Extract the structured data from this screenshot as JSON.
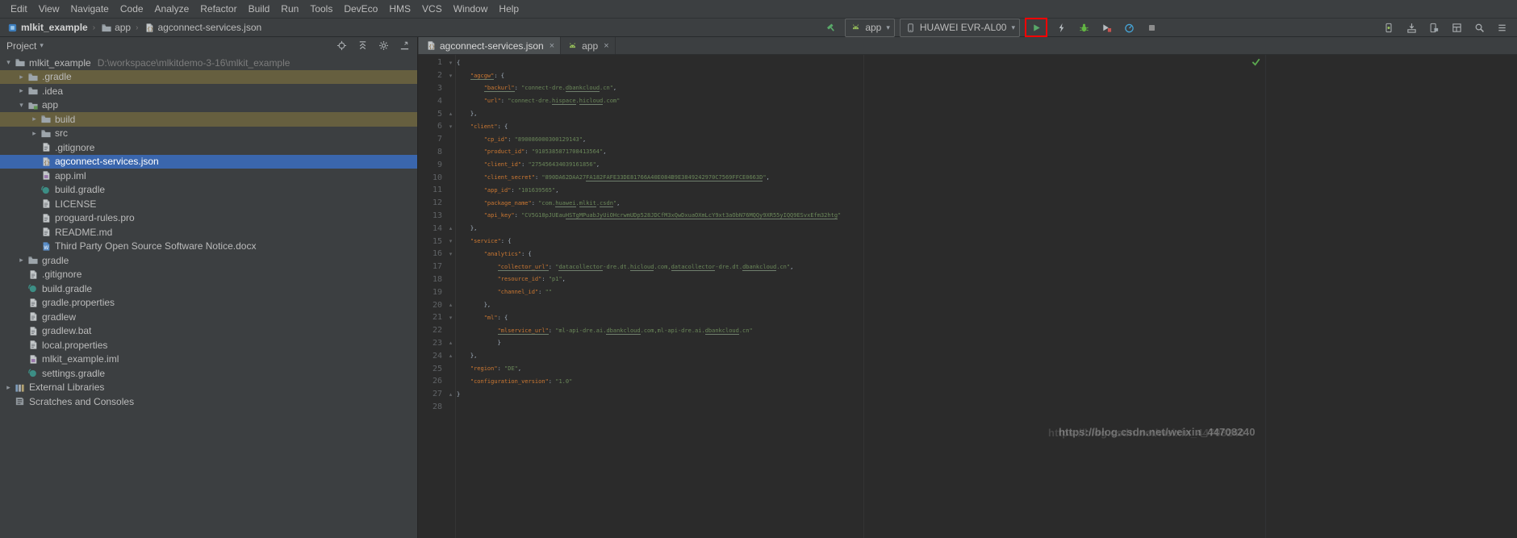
{
  "window_title": "mlkit_example - agconnect-services.json",
  "colors": {
    "panel_bg": "#3c3f41",
    "editor_bg": "#2b2b2b",
    "selection_blue": "#3a66ad",
    "excluded_row_olive": "#665f3f",
    "accent_green": "#59a869",
    "annotation_red": "#fe0000",
    "json_key": "#cc7832",
    "json_string": "#6a8759"
  },
  "menu": {
    "items": [
      "Edit",
      "View",
      "Navigate",
      "Code",
      "Analyze",
      "Refactor",
      "Build",
      "Run",
      "Tools",
      "DevEco",
      "HMS",
      "VCS",
      "Window",
      "Help"
    ]
  },
  "breadcrumbs": {
    "items": [
      {
        "label": "mlkit_example",
        "icon": "project"
      },
      {
        "label": "app",
        "icon": "folder"
      },
      {
        "label": "agconnect-services.json",
        "icon": "json"
      }
    ]
  },
  "run_toolbar": {
    "make_button": "make-project",
    "run_config": {
      "label": "app",
      "icon": "android"
    },
    "device_selector": {
      "label": "HUAWEI EVR-AL00",
      "icon": "phone"
    },
    "actions": [
      {
        "name": "run",
        "highlighted": true
      },
      {
        "name": "apply-changes"
      },
      {
        "name": "debug"
      },
      {
        "name": "run-with-coverage"
      },
      {
        "name": "profile"
      },
      {
        "name": "stop"
      }
    ],
    "right_actions": [
      {
        "name": "avd-manager"
      },
      {
        "name": "sdk-manager"
      },
      {
        "name": "device-file-explorer"
      },
      {
        "name": "layout-inspector"
      },
      {
        "name": "search-everywhere"
      },
      {
        "name": "toolbar-menu"
      }
    ]
  },
  "project_panel": {
    "title": "Project",
    "header_icons": [
      "locate",
      "collapse-all",
      "settings",
      "hide"
    ],
    "tree": [
      {
        "label": "mlkit_example",
        "path": "D:\\workspace\\mlkitdemo-3-16\\mlkit_example",
        "indent": 0,
        "icon": "folder",
        "arrow": "expanded"
      },
      {
        "label": ".gradle",
        "indent": 1,
        "icon": "folder",
        "arrow": "collapsed",
        "highlight": "excluded"
      },
      {
        "label": ".idea",
        "indent": 1,
        "icon": "folder",
        "arrow": "collapsed"
      },
      {
        "label": "app",
        "indent": 1,
        "icon": "module",
        "arrow": "expanded"
      },
      {
        "label": "build",
        "indent": 2,
        "icon": "folder",
        "arrow": "collapsed",
        "highlight": "excluded"
      },
      {
        "label": "src",
        "indent": 2,
        "icon": "folder",
        "arrow": "collapsed"
      },
      {
        "label": ".gitignore",
        "indent": 2,
        "icon": "file"
      },
      {
        "label": "agconnect-services.json",
        "indent": 2,
        "icon": "json",
        "selected": true
      },
      {
        "label": "app.iml",
        "indent": 2,
        "icon": "iml"
      },
      {
        "label": "build.gradle",
        "indent": 2,
        "icon": "gradle"
      },
      {
        "label": "LICENSE",
        "indent": 2,
        "icon": "file"
      },
      {
        "label": "proguard-rules.pro",
        "indent": 2,
        "icon": "file"
      },
      {
        "label": "README.md",
        "indent": 2,
        "icon": "file"
      },
      {
        "label": "Third Party Open Source Software Notice.docx",
        "indent": 2,
        "icon": "docx"
      },
      {
        "label": "gradle",
        "indent": 1,
        "icon": "folder",
        "arrow": "collapsed"
      },
      {
        "label": ".gitignore",
        "indent": 1,
        "icon": "file"
      },
      {
        "label": "build.gradle",
        "indent": 1,
        "icon": "gradle"
      },
      {
        "label": "gradle.properties",
        "indent": 1,
        "icon": "file"
      },
      {
        "label": "gradlew",
        "indent": 1,
        "icon": "file"
      },
      {
        "label": "gradlew.bat",
        "indent": 1,
        "icon": "file"
      },
      {
        "label": "local.properties",
        "indent": 1,
        "icon": "file"
      },
      {
        "label": "mlkit_example.iml",
        "indent": 1,
        "icon": "iml"
      },
      {
        "label": "settings.gradle",
        "indent": 1,
        "icon": "gradle"
      },
      {
        "label": "External Libraries",
        "indent": 0,
        "icon": "lib",
        "arrow": "collapsed"
      },
      {
        "label": "Scratches and Consoles",
        "indent": 0,
        "icon": "scratch"
      }
    ]
  },
  "editor": {
    "tabs": [
      {
        "label": "agconnect-services.json",
        "icon": "json",
        "active": true
      },
      {
        "label": "app",
        "icon": "android",
        "active": false
      }
    ],
    "lines": [
      {
        "n": 1,
        "fold": "open",
        "s": [
          [
            "p",
            "{"
          ]
        ]
      },
      {
        "n": 2,
        "fold": "open",
        "s": [
          [
            "p",
            "    "
          ],
          [
            "ku",
            "\"agcgw\""
          ],
          [
            "p",
            ": {"
          ]
        ]
      },
      {
        "n": 3,
        "fold": null,
        "s": [
          [
            "p",
            "        "
          ],
          [
            "ku",
            "\"backurl\""
          ],
          [
            "p",
            ": "
          ],
          [
            "s",
            "\"connect-dre."
          ],
          [
            "su",
            "dbankcloud"
          ],
          [
            "s",
            ".cn\""
          ],
          [
            "p",
            ","
          ]
        ]
      },
      {
        "n": 4,
        "fold": null,
        "s": [
          [
            "p",
            "        "
          ],
          [
            "k",
            "\"url\""
          ],
          [
            "p",
            ": "
          ],
          [
            "s",
            "\"connect-dre."
          ],
          [
            "su",
            "hispace"
          ],
          [
            "s",
            "."
          ],
          [
            "su",
            "hicloud"
          ],
          [
            "s",
            ".com\""
          ]
        ]
      },
      {
        "n": 5,
        "fold": "close",
        "s": [
          [
            "p",
            "    },"
          ]
        ]
      },
      {
        "n": 6,
        "fold": "open",
        "s": [
          [
            "p",
            "    "
          ],
          [
            "k",
            "\"client\""
          ],
          [
            "p",
            ": {"
          ]
        ]
      },
      {
        "n": 7,
        "fold": null,
        "s": [
          [
            "p",
            "        "
          ],
          [
            "k",
            "\"cp_id\""
          ],
          [
            "p",
            ": "
          ],
          [
            "s",
            "\"890086000300129143\""
          ],
          [
            "p",
            ","
          ]
        ]
      },
      {
        "n": 8,
        "fold": null,
        "s": [
          [
            "p",
            "        "
          ],
          [
            "k",
            "\"product_id\""
          ],
          [
            "p",
            ": "
          ],
          [
            "s",
            "\"9105385871708413564\""
          ],
          [
            "p",
            ","
          ]
        ]
      },
      {
        "n": 9,
        "fold": null,
        "s": [
          [
            "p",
            "        "
          ],
          [
            "k",
            "\"client_id\""
          ],
          [
            "p",
            ": "
          ],
          [
            "s",
            "\"275456434039161856\""
          ],
          [
            "p",
            ","
          ]
        ]
      },
      {
        "n": 10,
        "fold": null,
        "s": [
          [
            "p",
            "        "
          ],
          [
            "k",
            "\"client_secret\""
          ],
          [
            "p",
            ": "
          ],
          [
            "s",
            "\"890DA62DAA27"
          ],
          [
            "su",
            "FA182FAFE33DE81766A40E084B9E3849242970C7569FFCE0663D"
          ],
          [
            "s",
            "\""
          ],
          [
            "p",
            ","
          ]
        ]
      },
      {
        "n": 11,
        "fold": null,
        "s": [
          [
            "p",
            "        "
          ],
          [
            "k",
            "\"app_id\""
          ],
          [
            "p",
            ": "
          ],
          [
            "s",
            "\"101639565\""
          ],
          [
            "p",
            ","
          ]
        ]
      },
      {
        "n": 12,
        "fold": null,
        "s": [
          [
            "p",
            "        "
          ],
          [
            "k",
            "\"package_name\""
          ],
          [
            "p",
            ": "
          ],
          [
            "s",
            "\"com."
          ],
          [
            "su",
            "huawei"
          ],
          [
            "s",
            "."
          ],
          [
            "su",
            "mlkit"
          ],
          [
            "s",
            "."
          ],
          [
            "su",
            "csdn"
          ],
          [
            "s",
            "\""
          ],
          [
            "p",
            ","
          ]
        ]
      },
      {
        "n": 13,
        "fold": null,
        "s": [
          [
            "p",
            "        "
          ],
          [
            "k",
            "\"api_key\""
          ],
          [
            "p",
            ": "
          ],
          [
            "s",
            "\"CV5G18pJUEau"
          ],
          [
            "su",
            "HSTgMPuabJyUiOHcrwmUDp528JDCfM3xQwDxuaOXmLcY9xt3aObN76MQQy9XR55yIQQ9ESvxEfm32htg"
          ],
          [
            "s",
            "\""
          ]
        ]
      },
      {
        "n": 14,
        "fold": "close",
        "s": [
          [
            "p",
            "    },"
          ]
        ]
      },
      {
        "n": 15,
        "fold": "open",
        "s": [
          [
            "p",
            "    "
          ],
          [
            "k",
            "\"service\""
          ],
          [
            "p",
            ": {"
          ]
        ]
      },
      {
        "n": 16,
        "fold": "open",
        "s": [
          [
            "p",
            "        "
          ],
          [
            "k",
            "\"analytics\""
          ],
          [
            "p",
            ": {"
          ]
        ]
      },
      {
        "n": 17,
        "fold": null,
        "s": [
          [
            "p",
            "            "
          ],
          [
            "ku",
            "\"collector_url\""
          ],
          [
            "p",
            ": "
          ],
          [
            "s",
            "\""
          ],
          [
            "su",
            "datacollector"
          ],
          [
            "s",
            "-dre.dt."
          ],
          [
            "su",
            "hicloud"
          ],
          [
            "s",
            ".com,"
          ],
          [
            "su",
            "datacollector"
          ],
          [
            "s",
            "-dre.dt."
          ],
          [
            "su",
            "dbankcloud"
          ],
          [
            "s",
            ".cn\""
          ],
          [
            "p",
            ","
          ]
        ]
      },
      {
        "n": 18,
        "fold": null,
        "s": [
          [
            "p",
            "            "
          ],
          [
            "k",
            "\"resource_id\""
          ],
          [
            "p",
            ": "
          ],
          [
            "s",
            "\"p1\""
          ],
          [
            "p",
            ","
          ]
        ]
      },
      {
        "n": 19,
        "fold": null,
        "s": [
          [
            "p",
            "            "
          ],
          [
            "k",
            "\"channel_id\""
          ],
          [
            "p",
            ": "
          ],
          [
            "s",
            "\"\""
          ]
        ]
      },
      {
        "n": 20,
        "fold": "close",
        "s": [
          [
            "p",
            "        },"
          ]
        ]
      },
      {
        "n": 21,
        "fold": "open",
        "s": [
          [
            "p",
            "        "
          ],
          [
            "k",
            "\"ml\""
          ],
          [
            "p",
            ": {"
          ]
        ]
      },
      {
        "n": 22,
        "fold": null,
        "s": [
          [
            "p",
            "            "
          ],
          [
            "ku",
            "\"mlservice_url\""
          ],
          [
            "p",
            ": "
          ],
          [
            "s",
            "\"ml-api-dre.ai."
          ],
          [
            "su",
            "dbankcloud"
          ],
          [
            "s",
            ".com,ml-api-dre.ai."
          ],
          [
            "su",
            "dbankcloud"
          ],
          [
            "s",
            ".cn\""
          ]
        ]
      },
      {
        "n": 23,
        "fold": "close",
        "s": [
          [
            "p",
            "            }"
          ]
        ]
      },
      {
        "n": 24,
        "fold": "close",
        "s": [
          [
            "p",
            "    },"
          ]
        ]
      },
      {
        "n": 25,
        "fold": null,
        "s": [
          [
            "p",
            "    "
          ],
          [
            "k",
            "\"region\""
          ],
          [
            "p",
            ": "
          ],
          [
            "s",
            "\"DE\""
          ],
          [
            "p",
            ","
          ]
        ]
      },
      {
        "n": 26,
        "fold": null,
        "s": [
          [
            "p",
            "    "
          ],
          [
            "k",
            "\"configuration_version\""
          ],
          [
            "p",
            ": "
          ],
          [
            "s",
            "\"1.0\""
          ]
        ]
      },
      {
        "n": 27,
        "fold": "close",
        "s": [
          [
            "p",
            "}"
          ]
        ]
      },
      {
        "n": 28,
        "fold": null,
        "s": []
      }
    ]
  },
  "watermark": "https://blog.csdn.net/weixin_44708240"
}
